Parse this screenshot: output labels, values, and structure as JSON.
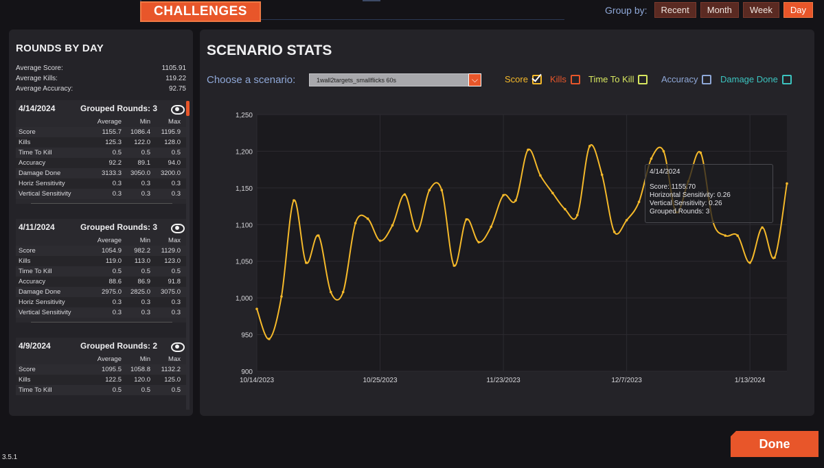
{
  "header": {
    "tab_label": "CHALLENGES",
    "group_by_label": "Group by:",
    "group_buttons": [
      {
        "label": "Recent",
        "active": false
      },
      {
        "label": "Month",
        "active": false
      },
      {
        "label": "Week",
        "active": false
      },
      {
        "label": "Day",
        "active": true
      }
    ]
  },
  "left": {
    "title": "ROUNDS BY DAY",
    "averages": [
      {
        "label": "Average Score:",
        "value": "1105.91"
      },
      {
        "label": "Average Kills:",
        "value": "119.22"
      },
      {
        "label": "Average Accuracy:",
        "value": "92.75"
      }
    ],
    "col_headers": {
      "avg": "Average",
      "min": "Min",
      "max": "Max"
    },
    "days": [
      {
        "date": "4/14/2024",
        "grouped": "Grouped Rounds: 3",
        "rows": [
          [
            "Score",
            "1155.7",
            "1086.4",
            "1195.9"
          ],
          [
            "Kills",
            "125.3",
            "122.0",
            "128.0"
          ],
          [
            "Time To Kill",
            "0.5",
            "0.5",
            "0.5"
          ],
          [
            "Accuracy",
            "92.2",
            "89.1",
            "94.0"
          ],
          [
            "Damage Done",
            "3133.3",
            "3050.0",
            "3200.0"
          ],
          [
            "Horiz Sensitivity",
            "0.3",
            "0.3",
            "0.3"
          ],
          [
            "Vertical Sensitivity",
            "0.3",
            "0.3",
            "0.3"
          ]
        ]
      },
      {
        "date": "4/11/2024",
        "grouped": "Grouped Rounds: 3",
        "rows": [
          [
            "Score",
            "1054.9",
            "982.2",
            "1129.0"
          ],
          [
            "Kills",
            "119.0",
            "113.0",
            "123.0"
          ],
          [
            "Time To Kill",
            "0.5",
            "0.5",
            "0.5"
          ],
          [
            "Accuracy",
            "88.6",
            "86.9",
            "91.8"
          ],
          [
            "Damage Done",
            "2975.0",
            "2825.0",
            "3075.0"
          ],
          [
            "Horiz Sensitivity",
            "0.3",
            "0.3",
            "0.3"
          ],
          [
            "Vertical Sensitivity",
            "0.3",
            "0.3",
            "0.3"
          ]
        ]
      },
      {
        "date": "4/9/2024",
        "grouped": "Grouped Rounds: 2",
        "rows": [
          [
            "Score",
            "1095.5",
            "1058.8",
            "1132.2"
          ],
          [
            "Kills",
            "122.5",
            "120.0",
            "125.0"
          ],
          [
            "Time To Kill",
            "0.5",
            "0.5",
            "0.5"
          ]
        ]
      }
    ]
  },
  "right": {
    "title": "SCENARIO STATS",
    "choose_label": "Choose a scenario:",
    "scenario_value": "1wall2targets_smallflicks 60s",
    "legend": [
      {
        "label": "Score",
        "color": "#f5b92a",
        "checked": true
      },
      {
        "label": "Kills",
        "color": "#e8562a",
        "checked": false
      },
      {
        "label": "Time To Kill",
        "color": "#d8e860",
        "checked": false
      },
      {
        "label": "Accuracy",
        "color": "#8fa8d8",
        "checked": false
      },
      {
        "label": "Damage Done",
        "color": "#3cc4c0",
        "checked": false
      }
    ],
    "tooltip": {
      "date": "4/14/2024",
      "lines": [
        "Score: 1155.70",
        "Horizontal Sensitivity: 0.26",
        "Vertical Sensitivity: 0.26",
        "Grouped Rounds: 3"
      ]
    }
  },
  "chart_data": {
    "type": "line",
    "ylim": [
      900,
      1250
    ],
    "yticks": [
      "900",
      "950",
      "1,000",
      "1,050",
      "1,100",
      "1,150",
      "1,200",
      "1,250"
    ],
    "xtick_labels": [
      "10/14/2023",
      "10/25/2023",
      "11/23/2023",
      "12/7/2023",
      "1/13/2024"
    ],
    "xtick_index": [
      0,
      10,
      20,
      30,
      40
    ],
    "grid": true,
    "series": [
      {
        "color": "#f5b92a",
        "values": [
          985,
          944,
          1002,
          1133,
          1048,
          1085,
          1008,
          1008,
          1102,
          1108,
          1078,
          1099,
          1141,
          1091,
          1147,
          1147,
          1044,
          1107,
          1076,
          1097,
          1140,
          1133,
          1202,
          1167,
          1143,
          1121,
          1113,
          1207,
          1168,
          1090,
          1106,
          1131,
          1190,
          1200,
          1117,
          1159,
          1198,
          1104,
          1085,
          1085,
          1048,
          1096,
          1055,
          1156
        ]
      }
    ]
  },
  "footer": {
    "done_label": "Done",
    "version": "3.5.1"
  }
}
